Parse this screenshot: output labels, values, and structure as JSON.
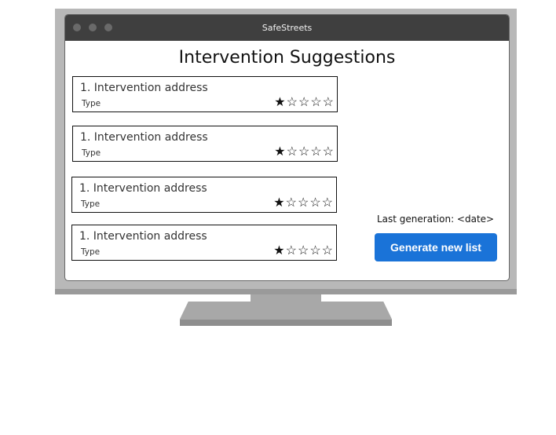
{
  "window": {
    "title": "SafeStreets"
  },
  "page": {
    "title": "Intervention Suggestions"
  },
  "suggestions": [
    {
      "address": "1. Intervention address",
      "type": "Type",
      "rating": 1,
      "max_rating": 5
    },
    {
      "address": "1. Intervention address",
      "type": "Type",
      "rating": 1,
      "max_rating": 5
    },
    {
      "address": "1. Intervention address",
      "type": "Type",
      "rating": 1,
      "max_rating": 5
    },
    {
      "address": "1. Intervention address",
      "type": "Type",
      "rating": 1,
      "max_rating": 5
    }
  ],
  "generation": {
    "last_generation_text": "Last generation: <date>",
    "button_label": "Generate new list"
  },
  "colors": {
    "button_bg": "#1a73d8",
    "titlebar": "#3f3f3f",
    "monitor_frame": "#b8b8b8"
  },
  "icons": {
    "star_filled": "star-filled-icon",
    "star_empty": "star-empty-icon"
  }
}
